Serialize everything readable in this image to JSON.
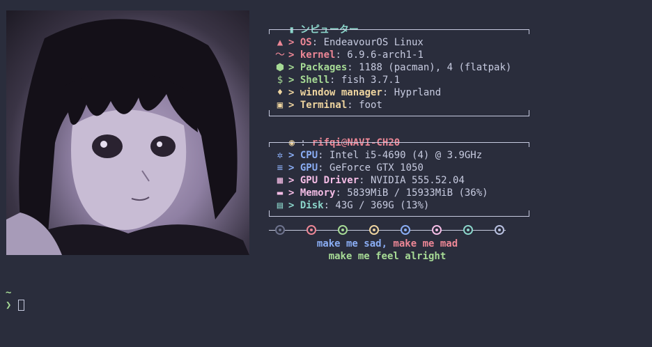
{
  "header": {
    "title": "ンピューター",
    "icon": "computer-icon",
    "color": "#8bd5ca"
  },
  "system": [
    {
      "icon": "arch-icon",
      "key": "OS",
      "value": ": EndeavourOS Linux",
      "color": "#ed8796"
    },
    {
      "icon": "chart-line-icon",
      "key": "kernel",
      "value": ": 6.9.6-arch1-1",
      "color": "#ed8796"
    },
    {
      "icon": "package-icon",
      "key": "Packages",
      "value": ": 1188 (pacman), 4 (flatpak)",
      "color": "#a6da95"
    },
    {
      "icon": "dollar-icon",
      "key": "Shell",
      "value": ": fish 3.7.1",
      "color": "#a6da95"
    },
    {
      "icon": "drop-icon",
      "key": "window manager",
      "value": ": Hyprland",
      "color": "#eed49f"
    },
    {
      "icon": "terminal-icon",
      "key": "Terminal",
      "value": ": foot",
      "color": "#eed49f"
    }
  ],
  "user": {
    "icon": "user-circle-icon",
    "sep": ": ",
    "name": "rifqi",
    "at": "@",
    "host": "NAVI-CH20",
    "color": "#ed8796",
    "icon_color": "#eed49f"
  },
  "hardware": [
    {
      "icon": "cpu-icon",
      "key": "CPU",
      "value": ": Intel i5-4690 (4) @ 3.9GHz",
      "color": "#8aadf4"
    },
    {
      "icon": "gpu-icon",
      "key": "GPU",
      "value": ": GeForce GTX 1050",
      "color": "#8aadf4"
    },
    {
      "icon": "driver-icon",
      "key": "GPU Driver",
      "value": ": NVIDIA 555.52.04",
      "color": "#f5bde6"
    },
    {
      "icon": "memory-icon",
      "key": "Memory",
      "value": ": 5839MiB / 15933MiB (36%)",
      "color": "#f5bde6"
    },
    {
      "icon": "disk-icon",
      "key": "Disk",
      "value": ": 43G / 369G (13%)",
      "color": "#8bd5ca"
    }
  ],
  "arrow": "> ",
  "palette": [
    "#6e738d",
    "#ed8796",
    "#a6da95",
    "#eed49f",
    "#8aadf4",
    "#f5bde6",
    "#8bd5ca",
    "#b8c0e0"
  ],
  "quote": {
    "part1": "make me sad",
    "comma": ", ",
    "part2": "make me mad",
    "line2": "make me feel alright",
    "color1": "#8aadf4",
    "color2": "#ed8796",
    "color3": "#a6da95"
  },
  "prompt": {
    "dir": "~",
    "symbol": "❯"
  }
}
